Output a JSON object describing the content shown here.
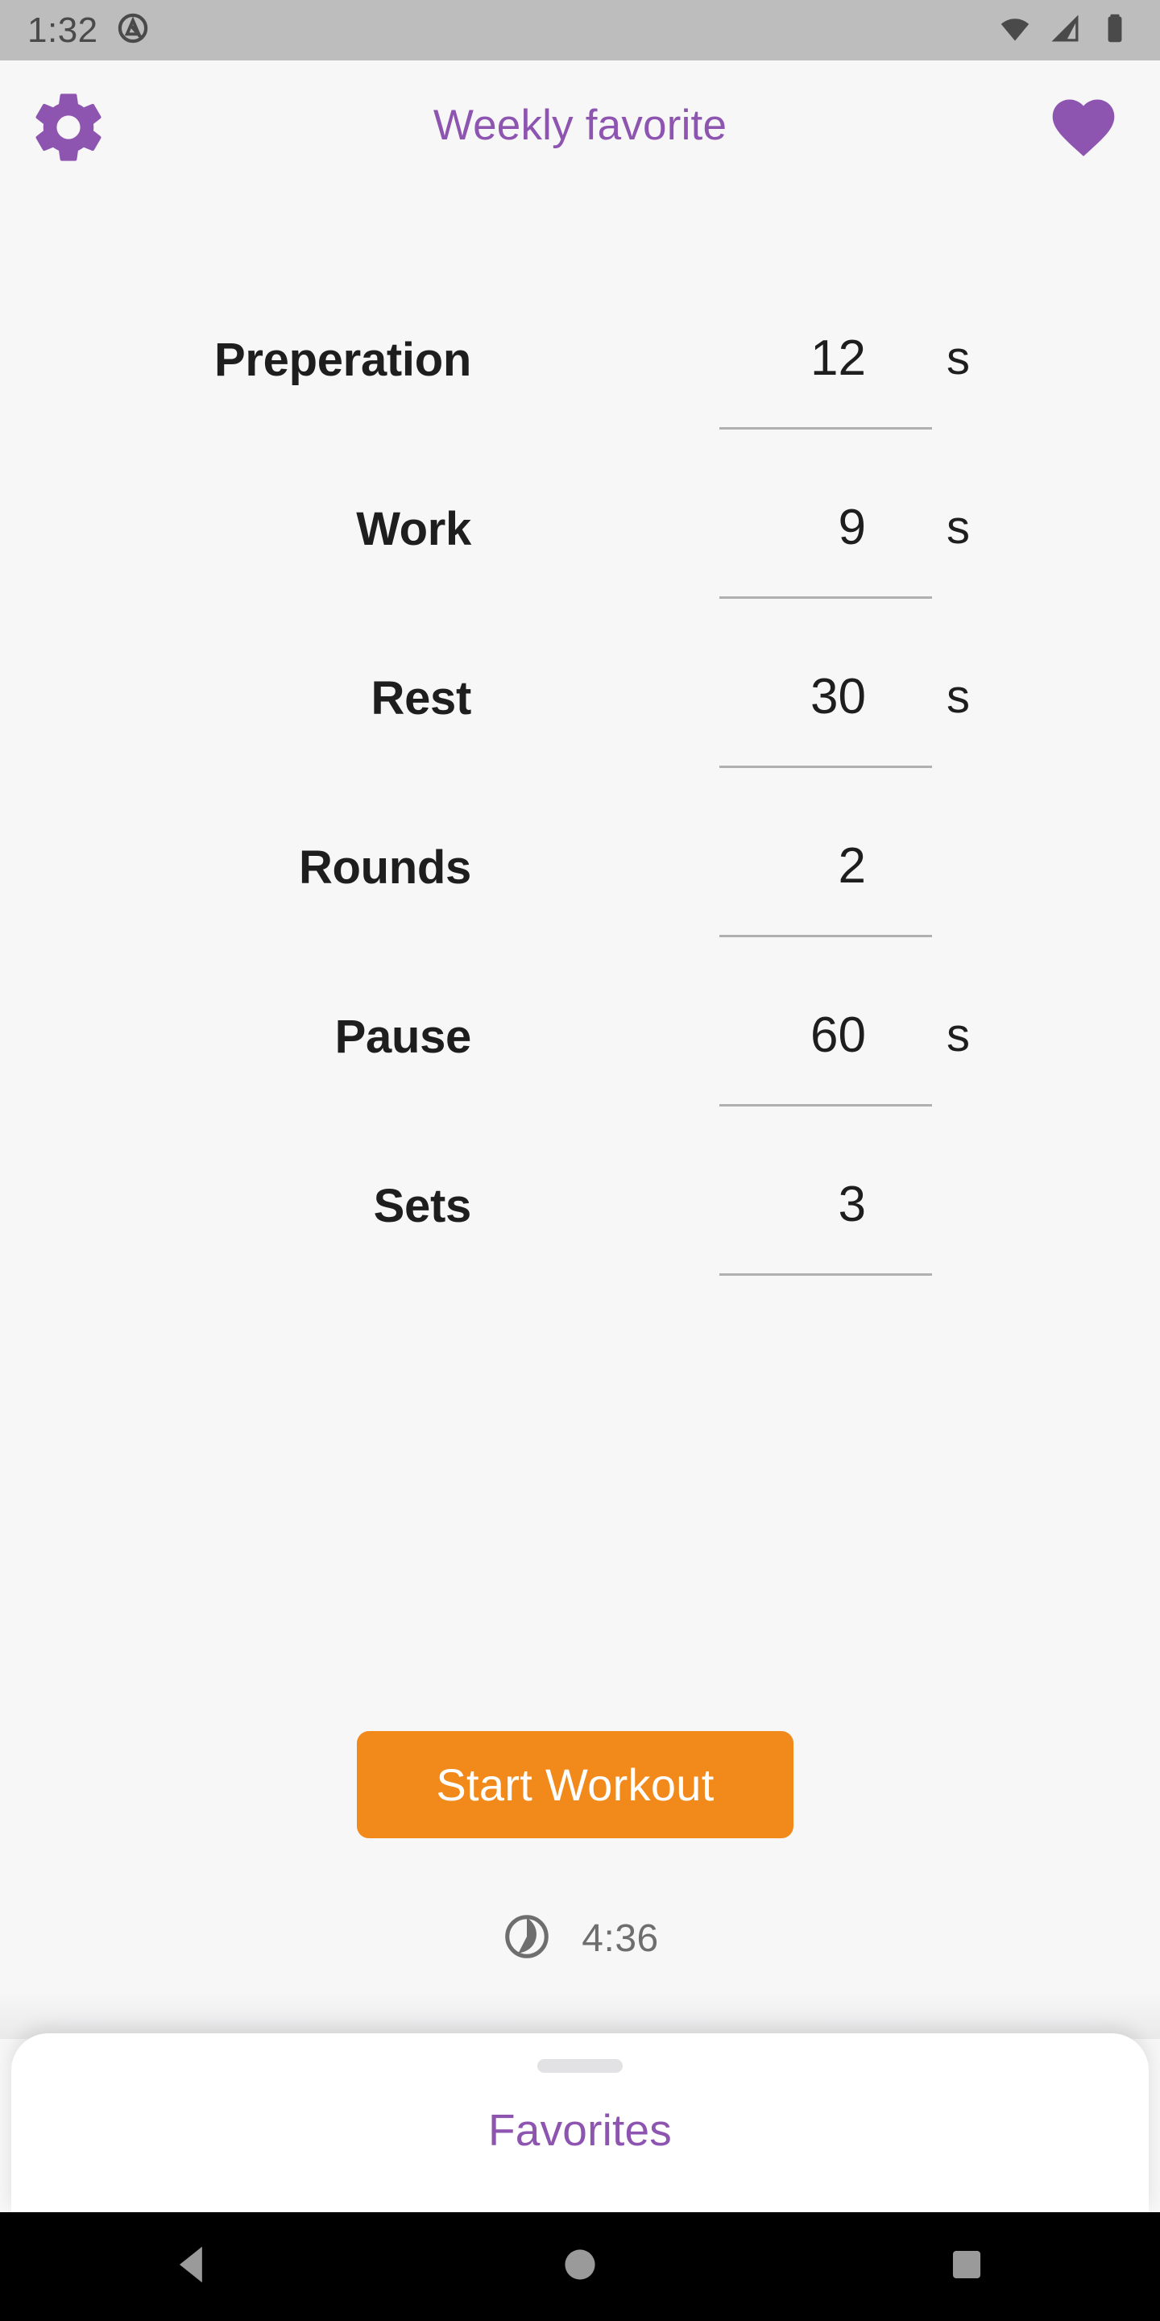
{
  "status_bar": {
    "clock": "1:32",
    "icons": {
      "notification": "android-q-icon",
      "wifi": "wifi-icon",
      "cellular": "cellular-signal-icon",
      "battery": "battery-icon"
    },
    "background_color": "#bdbdbd"
  },
  "header": {
    "settings_icon": "gear-icon",
    "title": "Weekly favorite",
    "favorite_icon": "heart-filled-icon",
    "accent_color": "#8e55b0"
  },
  "form": {
    "rows": [
      {
        "label": "Preperation",
        "value": "12",
        "unit": "s"
      },
      {
        "label": "Work",
        "value": "9",
        "unit": "s"
      },
      {
        "label": "Rest",
        "value": "30",
        "unit": "s"
      },
      {
        "label": "Rounds",
        "value": "2",
        "unit": ""
      },
      {
        "label": "Pause",
        "value": "60",
        "unit": "s"
      },
      {
        "label": "Sets",
        "value": "3",
        "unit": ""
      }
    ]
  },
  "actions": {
    "start_label": "Start Workout",
    "start_color": "#f18a1a"
  },
  "duration": {
    "icon": "timelapse-icon",
    "total": "4:36",
    "text_color": "#6e6e6e"
  },
  "bottom_sheet": {
    "handle": "drag-handle",
    "title": "Favorites",
    "accent_color": "#8e55b0"
  },
  "nav_bar": {
    "back": "back-triangle-icon",
    "home": "home-circle-icon",
    "recents": "recents-square-icon",
    "background_color": "#000000"
  }
}
